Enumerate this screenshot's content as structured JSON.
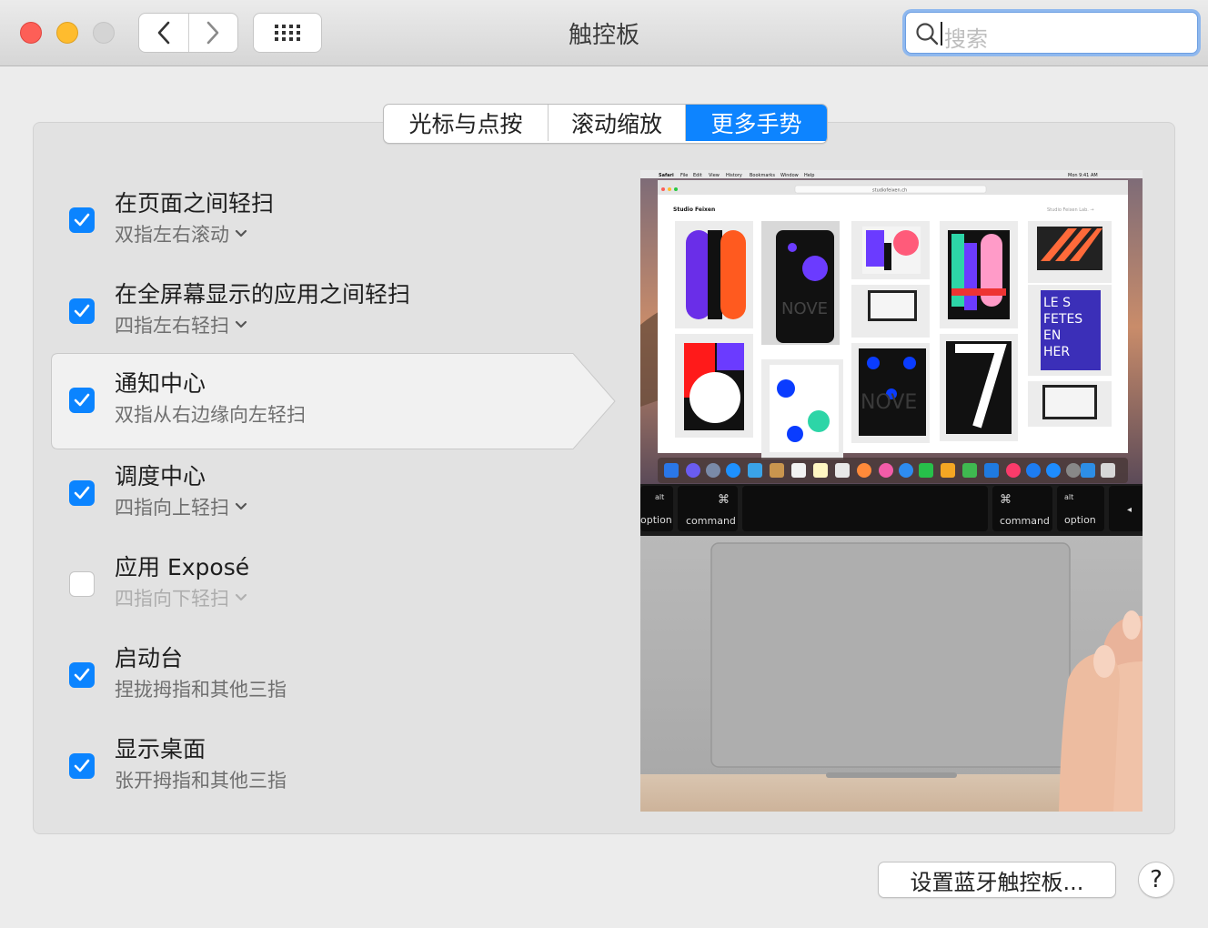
{
  "window": {
    "title": "触控板"
  },
  "search": {
    "placeholder": "搜索"
  },
  "tabs": [
    {
      "label": "光标与点按",
      "selected": false
    },
    {
      "label": "滚动缩放",
      "selected": false
    },
    {
      "label": "更多手势",
      "selected": true
    }
  ],
  "gestures": [
    {
      "title": "在页面之间轻扫",
      "subtitle": "双指左右滚动",
      "checked": true,
      "has_menu": true
    },
    {
      "title": "在全屏幕显示的应用之间轻扫",
      "subtitle": "四指左右轻扫",
      "checked": true,
      "has_menu": true
    },
    {
      "title": "通知中心",
      "subtitle": "双指从右边缘向左轻扫",
      "checked": true,
      "has_menu": false,
      "selected": true
    },
    {
      "title": "调度中心",
      "subtitle": "四指向上轻扫",
      "checked": true,
      "has_menu": true
    },
    {
      "title": "应用 Exposé",
      "subtitle": "四指向下轻扫",
      "checked": false,
      "has_menu": true
    },
    {
      "title": "启动台",
      "subtitle": "捏拢拇指和其他三指",
      "checked": true,
      "has_menu": false
    },
    {
      "title": "显示桌面",
      "subtitle": "张开拇指和其他三指",
      "checked": true,
      "has_menu": false
    }
  ],
  "preview": {
    "menubar": [
      "Safari",
      "File",
      "Edit",
      "View",
      "History",
      "Bookmarks",
      "Window",
      "Help"
    ],
    "menubar_time": "Mon 9:41 AM",
    "url": "studiofeixen.ch",
    "site_name": "Studio Feixen",
    "site_link": "Studio Feixen Lab. →",
    "keys": {
      "left_alt": "alt",
      "left_option": "option",
      "left_cmd_symbol": "⌘",
      "left_cmd": "command",
      "right_cmd_symbol": "⌘",
      "right_cmd": "command",
      "right_alt": "alt",
      "right_option": "option",
      "arrow": "◂"
    }
  },
  "footer": {
    "bluetooth_button": "设置蓝牙触控板...",
    "help_button": "?"
  },
  "colors": {
    "accent": "#0b84ff"
  }
}
